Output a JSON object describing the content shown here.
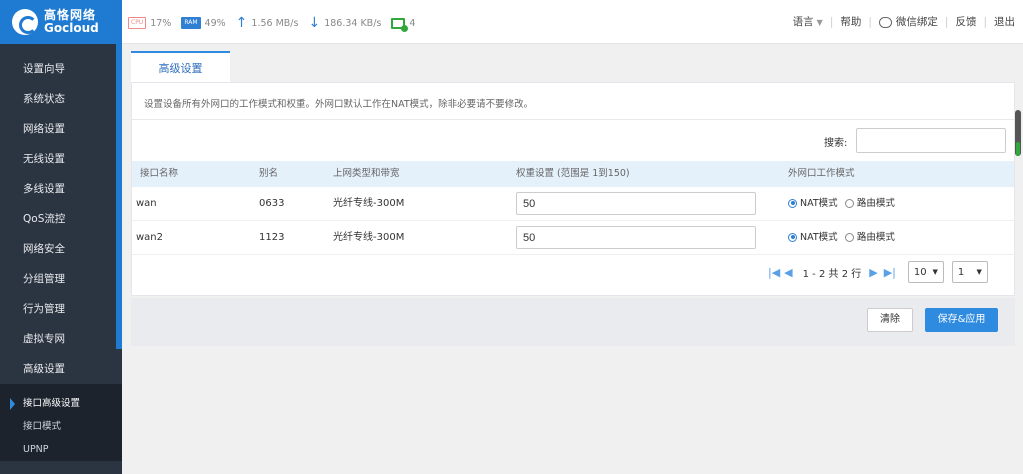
{
  "brand": {
    "name_cn": "高恪网络",
    "name_en": "Gocloud"
  },
  "stats": {
    "cpu_label": "CPU",
    "cpu": "17%",
    "ram_label": "RAM",
    "ram": "49%",
    "upload": "1.56 MB/s",
    "download": "186.34 KB/s",
    "devices": "4"
  },
  "topnav": {
    "language": "语言",
    "help": "帮助",
    "wechat_bind": "微信绑定",
    "feedback": "反馈",
    "logout": "退出"
  },
  "sidebar": {
    "items": [
      "设置向导",
      "系统状态",
      "网络设置",
      "无线设置",
      "多线设置",
      "QoS流控",
      "网络安全",
      "分组管理",
      "行为管理",
      "虚拟专网",
      "高级设置"
    ],
    "subitems": [
      "接口高级设置",
      "接口模式",
      "UPNP"
    ],
    "active_subitem": "接口高级设置"
  },
  "tab": {
    "label": "高级设置"
  },
  "description": "设置设备所有外网口的工作模式和权重。外网口默认工作在NAT模式，除非必要请不要修改。",
  "search": {
    "label": "搜索:",
    "value": ""
  },
  "table": {
    "headers": [
      "接口名称",
      "别名",
      "上网类型和带宽",
      "权重设置 (范围是 1到150)",
      "外网口工作模式"
    ],
    "rows": [
      {
        "name": "wan",
        "alias": "0633",
        "type": "光纤专线-300M",
        "weight": "50",
        "mode": "NAT模式"
      },
      {
        "name": "wan2",
        "alias": "1123",
        "type": "光纤专线-300M",
        "weight": "50",
        "mode": "NAT模式"
      }
    ],
    "mode_options": [
      "NAT模式",
      "路由模式"
    ]
  },
  "pager": {
    "summary": "1 - 2 共 2 行",
    "page_size": "10",
    "page": "1"
  },
  "buttons": {
    "clear": "清除",
    "save": "保存&应用"
  },
  "colors": {
    "brand": "#1f7bd1",
    "sidebar": "#2b3441",
    "accent": "#2f8be0"
  }
}
